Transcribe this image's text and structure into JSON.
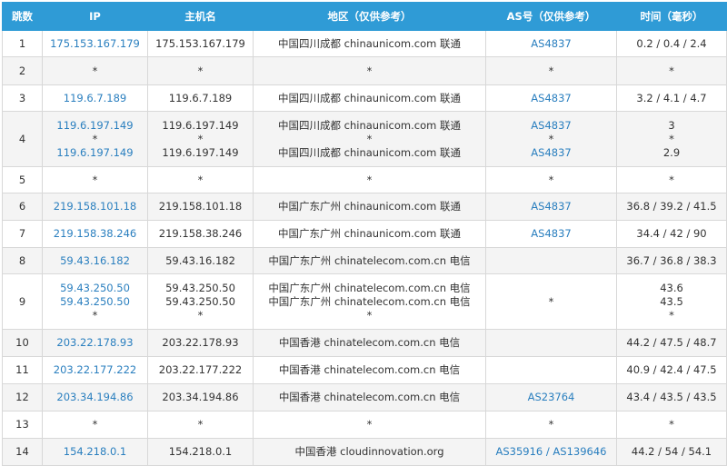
{
  "columns": [
    "跳数",
    "IP",
    "主机名",
    "地区（仅供参考）",
    "AS号（仅供参考）",
    "时间（毫秒）"
  ],
  "rows": [
    {
      "hop": "1",
      "ips": [
        "175.153.167.179"
      ],
      "hosts": [
        "175.153.167.179"
      ],
      "regions": [
        "中国四川成都 chinaunicom.com 联通"
      ],
      "as": [
        "AS4837"
      ],
      "times": [
        "0.2 / 0.4 / 2.4"
      ]
    },
    {
      "hop": "2",
      "ips": [
        "*"
      ],
      "hosts": [
        "*"
      ],
      "regions": [
        "*"
      ],
      "as": [
        "*"
      ],
      "times": [
        "*"
      ]
    },
    {
      "hop": "3",
      "ips": [
        "119.6.7.189"
      ],
      "hosts": [
        "119.6.7.189"
      ],
      "regions": [
        "中国四川成都 chinaunicom.com 联通"
      ],
      "as": [
        "AS4837"
      ],
      "times": [
        "3.2 / 4.1 / 4.7"
      ]
    },
    {
      "hop": "4",
      "ips": [
        "119.6.197.149",
        "*",
        "119.6.197.149"
      ],
      "hosts": [
        "119.6.197.149",
        "*",
        "119.6.197.149"
      ],
      "regions": [
        "中国四川成都 chinaunicom.com 联通",
        "*",
        "中国四川成都 chinaunicom.com 联通"
      ],
      "as": [
        "AS4837",
        "*",
        "AS4837"
      ],
      "times": [
        "3",
        "*",
        "2.9"
      ]
    },
    {
      "hop": "5",
      "ips": [
        "*"
      ],
      "hosts": [
        "*"
      ],
      "regions": [
        "*"
      ],
      "as": [
        "*"
      ],
      "times": [
        "*"
      ]
    },
    {
      "hop": "6",
      "ips": [
        "219.158.101.18"
      ],
      "hosts": [
        "219.158.101.18"
      ],
      "regions": [
        "中国广东广州 chinaunicom.com 联通"
      ],
      "as": [
        "AS4837"
      ],
      "times": [
        "36.8 / 39.2 / 41.5"
      ]
    },
    {
      "hop": "7",
      "ips": [
        "219.158.38.246"
      ],
      "hosts": [
        "219.158.38.246"
      ],
      "regions": [
        "中国广东广州 chinaunicom.com 联通"
      ],
      "as": [
        "AS4837"
      ],
      "times": [
        "34.4 / 42 / 90"
      ]
    },
    {
      "hop": "8",
      "ips": [
        "59.43.16.182"
      ],
      "hosts": [
        "59.43.16.182"
      ],
      "regions": [
        "中国广东广州 chinatelecom.com.cn 电信"
      ],
      "as": [],
      "times": [
        "36.7 / 36.8 / 38.3"
      ]
    },
    {
      "hop": "9",
      "ips": [
        "59.43.250.50",
        "59.43.250.50",
        "*"
      ],
      "hosts": [
        "59.43.250.50",
        "59.43.250.50",
        "*"
      ],
      "regions": [
        "中国广东广州 chinatelecom.com.cn 电信",
        "中国广东广州 chinatelecom.com.cn 电信",
        "*"
      ],
      "as": [
        "*"
      ],
      "times": [
        "43.6",
        "43.5",
        "*"
      ]
    },
    {
      "hop": "10",
      "ips": [
        "203.22.178.93"
      ],
      "hosts": [
        "203.22.178.93"
      ],
      "regions": [
        "中国香港 chinatelecom.com.cn 电信"
      ],
      "as": [],
      "times": [
        "44.2 / 47.5 / 48.7"
      ]
    },
    {
      "hop": "11",
      "ips": [
        "203.22.177.222"
      ],
      "hosts": [
        "203.22.177.222"
      ],
      "regions": [
        "中国香港 chinatelecom.com.cn 电信"
      ],
      "as": [],
      "times": [
        "40.9 / 42.4 / 47.5"
      ]
    },
    {
      "hop": "12",
      "ips": [
        "203.34.194.86"
      ],
      "hosts": [
        "203.34.194.86"
      ],
      "regions": [
        "中国香港 chinatelecom.com.cn 电信"
      ],
      "as": [
        "AS23764"
      ],
      "times": [
        "43.4 / 43.5 / 43.5"
      ]
    },
    {
      "hop": "13",
      "ips": [
        "*"
      ],
      "hosts": [
        "*"
      ],
      "regions": [
        "*"
      ],
      "as": [
        "*"
      ],
      "times": [
        "*"
      ]
    },
    {
      "hop": "14",
      "ips": [
        "154.218.0.1"
      ],
      "hosts": [
        "154.218.0.1"
      ],
      "regions": [
        "中国香港 cloudinnovation.org"
      ],
      "as": [
        "AS35916 / AS139646"
      ],
      "times": [
        "44.2 / 54 / 54.1"
      ]
    }
  ],
  "colors": {
    "header_bg": "#2f9bd6",
    "link": "#2a7fbf",
    "stripe": "#f4f4f4",
    "border": "#d8d8d8"
  }
}
